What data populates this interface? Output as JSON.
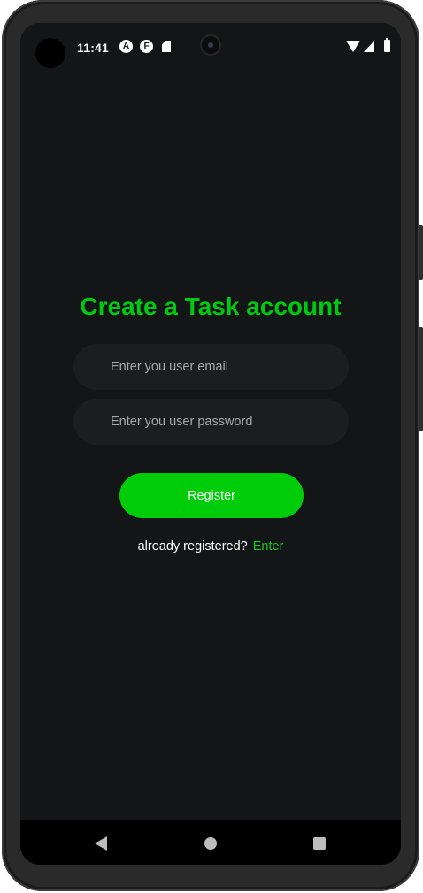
{
  "status_bar": {
    "time": "11:41",
    "notification_icons": [
      "A",
      "F"
    ],
    "icons": [
      "camera-cutout-icon",
      "app-notification-icon",
      "app-notification-icon",
      "sd-card-icon",
      "wifi-icon",
      "signal-icon",
      "battery-icon"
    ]
  },
  "register": {
    "title": "Create a Task account",
    "email_placeholder": "Enter you user email",
    "email_value": "",
    "password_placeholder": "Enter you user password",
    "password_value": "",
    "register_label": "Register",
    "already_text": "already registered?",
    "enter_link": "Enter"
  },
  "nav_bar": {
    "icons": [
      "back-icon",
      "home-icon",
      "recents-icon"
    ]
  },
  "colors": {
    "accent": "#00cc0a",
    "background": "#141517",
    "field_background": "#1c1d1f"
  }
}
